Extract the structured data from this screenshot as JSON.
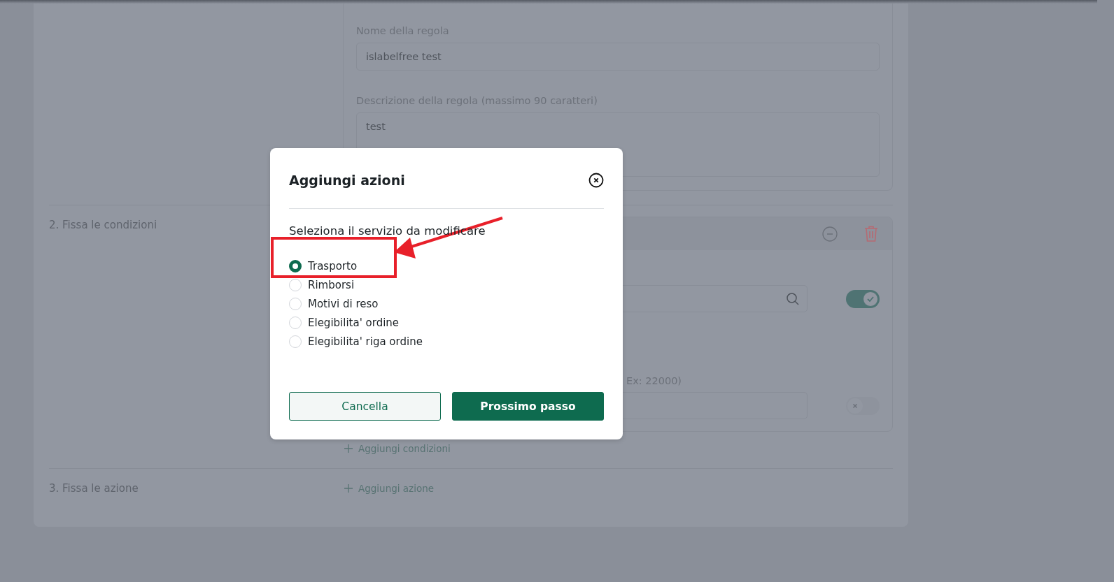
{
  "rule_form": {
    "fields": [
      {
        "label": "Nome della regola",
        "value": "islabelfree test",
        "kind": "input"
      },
      {
        "label": "Descrizione della regola (massimo 90 caratteri)",
        "value": "test",
        "kind": "textarea"
      }
    ]
  },
  "conditions_section": {
    "title": "2. Fissa le condizioni",
    "rows": [
      {
        "kind": "search",
        "on": true
      },
      {
        "kind": "text",
        "label": "Ex: 22000)",
        "on": false
      }
    ],
    "add_link": "Aggiungi condizioni"
  },
  "actions_section": {
    "title": "3. Fissa le azione",
    "add_link": "Aggiungi azione"
  },
  "modal": {
    "title": "Aggiungi azioni",
    "prompt": "Seleziona il servizio da modificare",
    "options": [
      {
        "label": "Trasporto",
        "selected": true
      },
      {
        "label": "Rimborsi",
        "selected": false
      },
      {
        "label": "Motivi di reso",
        "selected": false
      },
      {
        "label": "Elegibilita' ordine",
        "selected": false
      },
      {
        "label": "Elegibilita' riga ordine",
        "selected": false
      }
    ],
    "buttons": [
      {
        "label": "Cancella",
        "kind": "secondary"
      },
      {
        "label": "Prossimo passo",
        "kind": "primary"
      }
    ]
  }
}
